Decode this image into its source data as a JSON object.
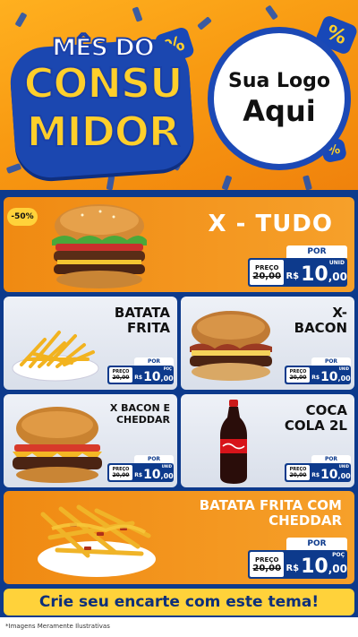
{
  "header": {
    "badge_line1": "MÊS DO",
    "badge_line2": "CONSU",
    "badge_line3": "MIDOR",
    "logo_line1": "Sua Logo",
    "logo_line2": "Aqui"
  },
  "products": [
    {
      "name": "X - TUDO",
      "discount": "-50%",
      "por_label": "POR",
      "preco_label": "PREÇO",
      "old_prefix": "R$",
      "old_price": "20,00",
      "currency": "R$",
      "price_int": "10",
      "price_dec": ",00",
      "unit": "UNID"
    },
    {
      "name_l1": "BATATA",
      "name_l2": "FRITA",
      "por_label": "POR",
      "preco_label": "PREÇO",
      "old_prefix": "R$",
      "old_price": "20,00",
      "currency": "R$",
      "price_int": "10",
      "price_dec": ",00",
      "unit": "POÇ"
    },
    {
      "name_l1": "X-",
      "name_l2": "BACON",
      "por_label": "POR",
      "preco_label": "PREÇO",
      "old_prefix": "R$",
      "old_price": "20,00",
      "currency": "R$",
      "price_int": "10",
      "price_dec": ",00",
      "unit": "UNID"
    },
    {
      "name_l1": "X BACON E",
      "name_l2": "CHEDDAR",
      "por_label": "POR",
      "preco_label": "PREÇO",
      "old_prefix": "R$",
      "old_price": "20,00",
      "currency": "R$",
      "price_int": "10",
      "price_dec": ",00",
      "unit": "UNID"
    },
    {
      "name_l1": "COCA",
      "name_l2": "COLA 2L",
      "por_label": "POR",
      "preco_label": "PREÇO",
      "old_prefix": "R$",
      "old_price": "20,00",
      "currency": "R$",
      "price_int": "10",
      "price_dec": ",00",
      "unit": "UNID"
    },
    {
      "name_l1": "BATATA FRITA COM",
      "name_l2": "CHEDDAR",
      "por_label": "POR",
      "preco_label": "PREÇO",
      "old_prefix": "R$",
      "old_price": "20,00",
      "currency": "R$",
      "price_int": "10",
      "price_dec": ",00",
      "unit": "POÇ"
    }
  ],
  "cta": "Crie seu encarte com este tema!",
  "footnote": "*Imagens Meramente Ilustrativas",
  "colors": {
    "orange": "#f08a12",
    "navy": "#0d3a8c",
    "yellow": "#ffd23a",
    "royal": "#1c49b5"
  },
  "icons": [
    "percent-tag-icon",
    "burger-image",
    "fries-image",
    "bacon-burger-image",
    "cheddar-burger-image",
    "cola-bottle-image",
    "cheddar-fries-image"
  ]
}
